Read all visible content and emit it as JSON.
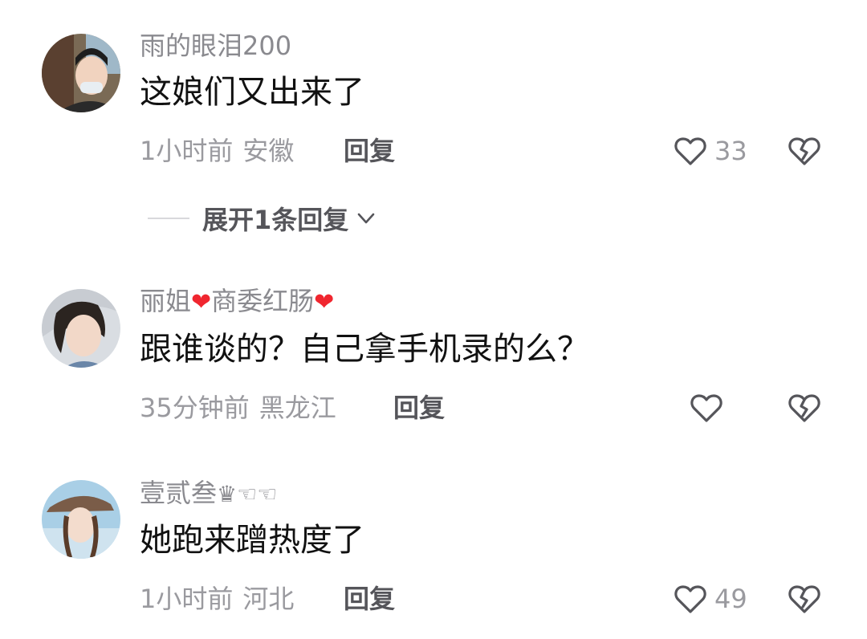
{
  "comments": [
    {
      "username": "雨的眼泪200",
      "text": "这娘们又出来了",
      "time": "1小时前",
      "location": "安徽",
      "reply_label": "回复",
      "likes": "33",
      "expand_label": "展开1条回复"
    },
    {
      "username_part1": "丽姐",
      "username_part2": "商委红肠",
      "text": "跟谁谈的？自己拿手机录的么？",
      "time": "35分钟前",
      "location": "黑龙江",
      "reply_label": "回复",
      "likes": ""
    },
    {
      "username": "壹贰叁",
      "username_suffix": "♛☜☜",
      "text": "她跑来蹭热度了",
      "time": "1小时前",
      "location": "河北",
      "reply_label": "回复",
      "likes": "49"
    }
  ],
  "icons": {
    "like": "heart-outline-icon",
    "dislike": "broken-heart-icon",
    "expand": "chevron-down-icon"
  },
  "colors": {
    "username": "#8a8a8f",
    "text": "#111111",
    "meta": "#9a9a9f",
    "reply": "#55555a",
    "heart_emoji": "#f0262f"
  }
}
